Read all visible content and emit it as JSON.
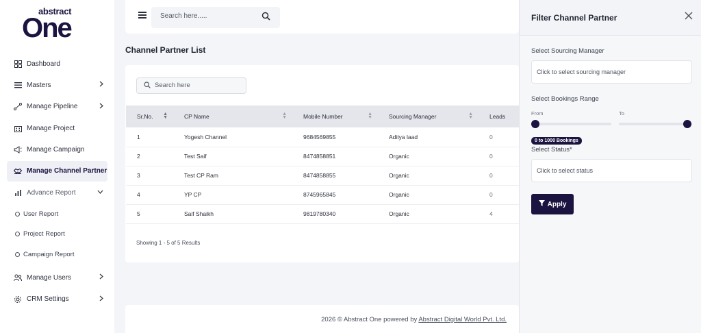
{
  "brand": {
    "logo_small": "abstract",
    "logo_big": "One"
  },
  "sidebar": {
    "items": [
      {
        "label": "Dashboard"
      },
      {
        "label": "Masters"
      },
      {
        "label": "Manage Pipeline"
      },
      {
        "label": "Manage Project"
      },
      {
        "label": "Manage Campaign"
      },
      {
        "label": "Manage Channel Partner"
      },
      {
        "label": "Advance Report"
      }
    ],
    "sub_items": [
      {
        "label": "User Report"
      },
      {
        "label": "Project Report"
      },
      {
        "label": "Campaign Report"
      }
    ],
    "bottom_items": [
      {
        "label": "Manage Users"
      },
      {
        "label": "CRM Settings"
      }
    ]
  },
  "header": {
    "search_placeholder": "Search here....."
  },
  "main": {
    "title": "Channel Partner List",
    "search_placeholder": "Search here",
    "columns": [
      "Sr.No.",
      "CP Name",
      "Mobile Number",
      "Sourcing Manager",
      "Leads"
    ],
    "rows": [
      [
        "1",
        "Yogesh Channel",
        "9684569855",
        "Aditya laad",
        "0"
      ],
      [
        "2",
        "Test Saif",
        "8474858851",
        "Organic",
        "0"
      ],
      [
        "3",
        "Test CP Ram",
        "8474858855",
        "Organic",
        "0"
      ],
      [
        "4",
        "YP CP",
        "8745965845",
        "Organic",
        "0"
      ],
      [
        "5",
        "Saif Shaikh",
        "9819780340",
        "Organic",
        "4"
      ]
    ],
    "showing": "Showing 1 - 5 of 5 Results"
  },
  "footer": {
    "text": "2026 © Abstract One powered by ",
    "link": "Abstract Digital World Pvt. Ltd."
  },
  "filter": {
    "title": "Filter Channel Partner",
    "sourcing_label": "Select Sourcing Manager",
    "sourcing_placeholder": "Click to select sourcing manager",
    "bookings_label": "Select Bookings Range",
    "from_label": "From",
    "to_label": "To",
    "range_badge": "0 to 1000 Bookings",
    "status_label": "Select Status*",
    "status_placeholder": "Click to select status",
    "apply_label": "Apply"
  },
  "colors": {
    "primary": "#1b1340",
    "accent": "#7b2ff7"
  }
}
